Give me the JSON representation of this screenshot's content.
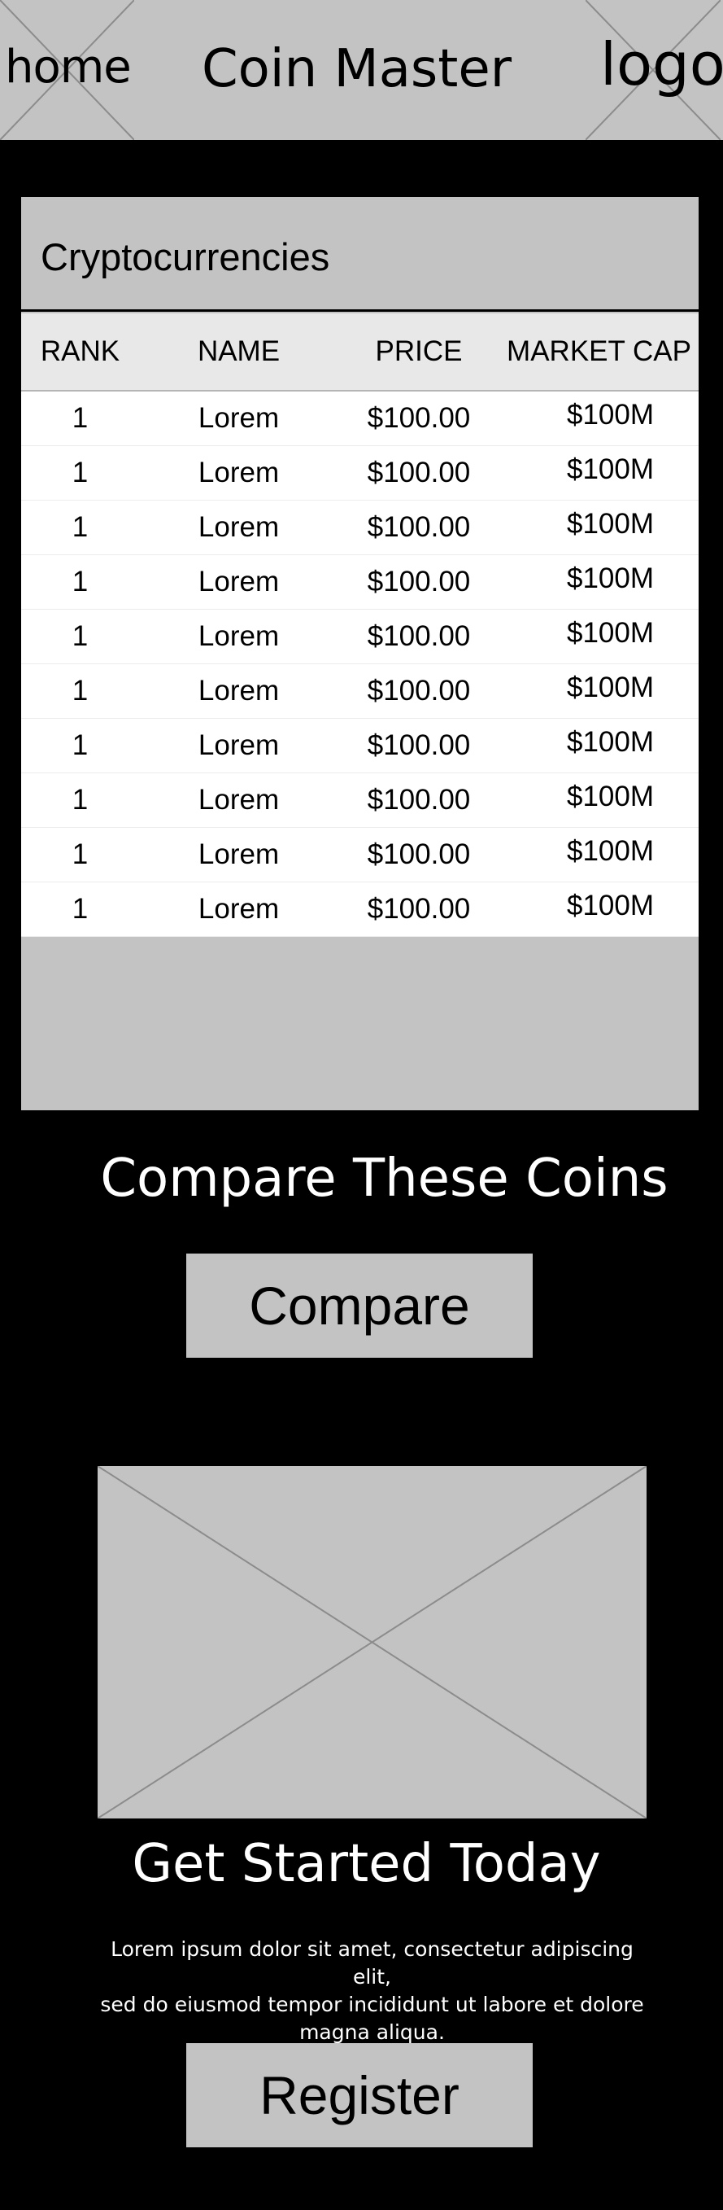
{
  "header": {
    "home_label": "home",
    "title": "Coin Master",
    "logo_label": "logo"
  },
  "panel": {
    "title": "Cryptocurrencies",
    "columns": [
      "RANK",
      "NAME",
      "PRICE",
      "MARKET CAP"
    ],
    "rows": [
      {
        "rank": "1",
        "name": "Lorem",
        "price": "$100.00",
        "market_cap": "$100M"
      },
      {
        "rank": "1",
        "name": "Lorem",
        "price": "$100.00",
        "market_cap": "$100M"
      },
      {
        "rank": "1",
        "name": "Lorem",
        "price": "$100.00",
        "market_cap": "$100M"
      },
      {
        "rank": "1",
        "name": "Lorem",
        "price": "$100.00",
        "market_cap": "$100M"
      },
      {
        "rank": "1",
        "name": "Lorem",
        "price": "$100.00",
        "market_cap": "$100M"
      },
      {
        "rank": "1",
        "name": "Lorem",
        "price": "$100.00",
        "market_cap": "$100M"
      },
      {
        "rank": "1",
        "name": "Lorem",
        "price": "$100.00",
        "market_cap": "$100M"
      },
      {
        "rank": "1",
        "name": "Lorem",
        "price": "$100.00",
        "market_cap": "$100M"
      },
      {
        "rank": "1",
        "name": "Lorem",
        "price": "$100.00",
        "market_cap": "$100M"
      },
      {
        "rank": "1",
        "name": "Lorem",
        "price": "$100.00",
        "market_cap": "$100M"
      }
    ]
  },
  "compare": {
    "heading": "Compare These Coins",
    "button_label": "Compare"
  },
  "get_started": {
    "heading": "Get Started Today",
    "body_line1": "Lorem ipsum dolor sit amet, consectetur adipiscing elit,",
    "body_line2": "sed do eiusmod tempor incididunt ut labore et dolore",
    "body_line3": "magna aliqua.",
    "button_label": "Register"
  },
  "colors": {
    "background": "#000000",
    "placeholder_gray": "#c3c3c3",
    "table_header_bg": "#e8e8e8",
    "text_light": "#ffffff"
  }
}
